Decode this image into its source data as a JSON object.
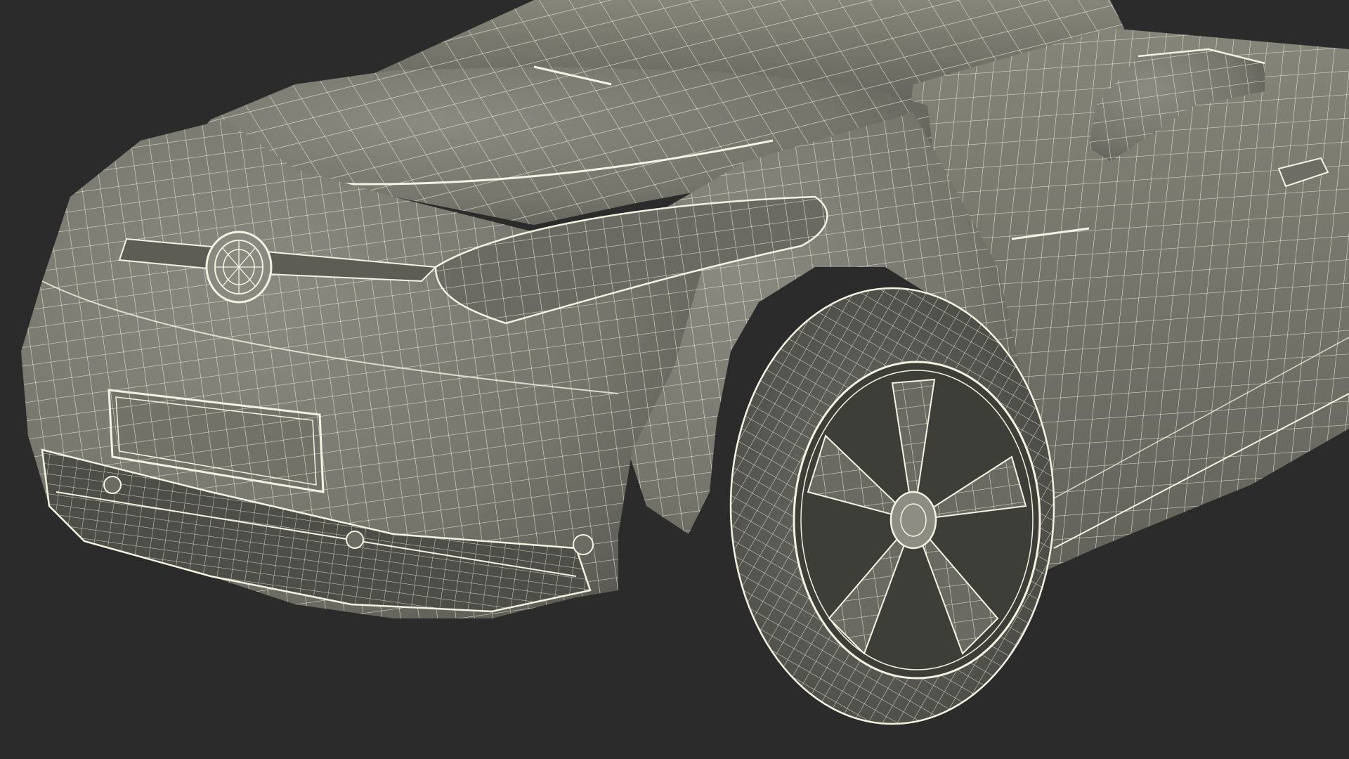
{
  "scene": {
    "background_color": "#2b2b2b",
    "body_fill": "#76766d",
    "body_shadow": "#5d5d55",
    "body_highlight": "#8b8b82",
    "wire_color": "#f4f2e2",
    "tire_color": "#656560",
    "rim_dark": "#3e3e38",
    "icon": "car-wireframe-icon"
  }
}
